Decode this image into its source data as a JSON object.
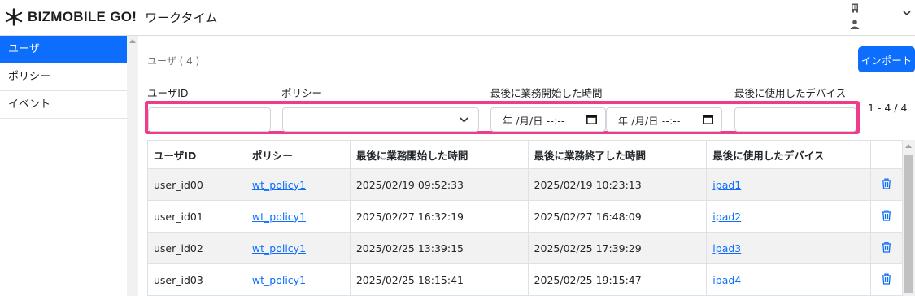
{
  "header": {
    "brand": "BIZMOBILE GO!",
    "app_title": "ワークタイム",
    "icons": [
      "logo-asterisk-icon",
      "building-icon",
      "user-icon",
      "chevron-down-icon"
    ]
  },
  "sidebar": {
    "items": [
      {
        "label": "ユーザ",
        "active": true
      },
      {
        "label": "ポリシー",
        "active": false
      },
      {
        "label": "イベント",
        "active": false
      }
    ]
  },
  "main": {
    "section_title": "ユーザ ( 4 )",
    "import_label": "インポート",
    "filters": {
      "user_id_label": "ユーザID",
      "policy_label": "ポリシー",
      "last_start_label": "最後に業務開始した時間",
      "last_device_label": "最後に使用したデバイス",
      "date_from_value": "年 /月/日 --:--",
      "date_to_value": "年 /月/日 --:--"
    },
    "pagination": "1 - 4 / 4",
    "table": {
      "columns": [
        "ユーザID",
        "ポリシー",
        "最後に業務開始した時間",
        "最後に業務終了した時間",
        "最後に使用したデバイス",
        ""
      ],
      "rows": [
        {
          "user_id": "user_id00",
          "policy": "wt_policy1",
          "start": "2025/02/19 09:52:33",
          "end": "2025/02/19 10:23:13",
          "device": "ipad1"
        },
        {
          "user_id": "user_id01",
          "policy": "wt_policy1",
          "start": "2025/02/27 16:32:19",
          "end": "2025/02/27 16:48:09",
          "device": "ipad2"
        },
        {
          "user_id": "user_id02",
          "policy": "wt_policy1",
          "start": "2025/02/25 13:39:15",
          "end": "2025/02/25 17:39:29",
          "device": "ipad3"
        },
        {
          "user_id": "user_id03",
          "policy": "wt_policy1",
          "start": "2025/02/25 18:15:41",
          "end": "2025/02/25 19:15:47",
          "device": "ipad4"
        }
      ]
    }
  },
  "colors": {
    "accent": "#0d6efd",
    "highlight": "#ef3c8a",
    "stripe": "#f2f2f2"
  }
}
